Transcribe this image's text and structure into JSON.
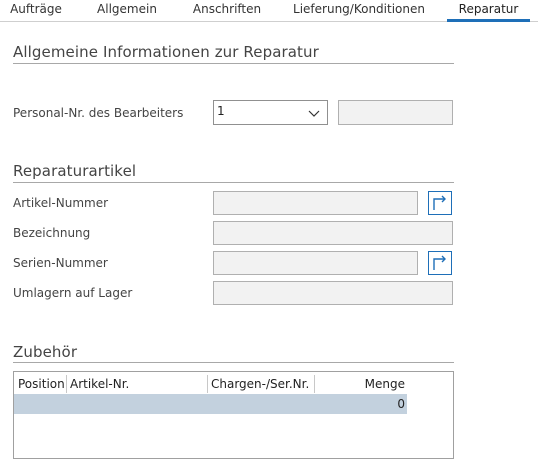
{
  "tabs": [
    {
      "label": "Aufträge"
    },
    {
      "label": "Allgemein"
    },
    {
      "label": "Anschriften"
    },
    {
      "label": "Lieferung/Konditionen"
    },
    {
      "label": "Reparatur",
      "active": true
    }
  ],
  "sections": {
    "general": {
      "title": "Allgemeine Informationen zur Reparatur",
      "personal_label": "Personal-Nr. des Bearbeiters",
      "personal_value": "1",
      "personal_name": ""
    },
    "article": {
      "title": "Reparaturartikel",
      "article_number_label": "Artikel-Nummer",
      "article_number_value": "",
      "description_label": "Bezeichnung",
      "description_value": "",
      "serial_label": "Serien-Nummer",
      "serial_value": "",
      "relocate_label": "Umlagern auf Lager",
      "relocate_value": ""
    },
    "accessories": {
      "title": "Zubehör",
      "columns": [
        "Position",
        "Artikel-Nr.",
        "Chargen-/Ser.Nr.",
        "Menge"
      ],
      "rows": [
        {
          "position": "",
          "article": "",
          "batch": "",
          "quantity": "0"
        }
      ]
    }
  },
  "icons": {
    "dropdown": "chevron-down-icon",
    "goto": "goto-arrow-icon"
  },
  "colors": {
    "accent": "#1e6fb8",
    "selected_row": "#c3d1de",
    "field_bg": "#f2f2f2"
  }
}
